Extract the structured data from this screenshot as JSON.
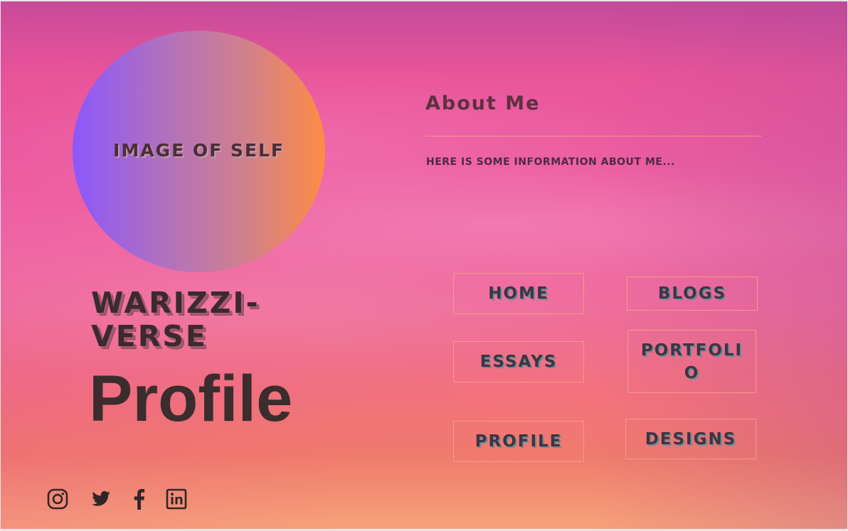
{
  "avatar": {
    "label": "IMAGE OF SELF"
  },
  "brand": {
    "name": "WARIZZI-\nVERSE",
    "subtitle": "Profile"
  },
  "about": {
    "title": "About Me",
    "text": "here is some information about me..."
  },
  "nav": {
    "home": "HOME",
    "blogs": "BLOGS",
    "essays": "ESSAYS",
    "portfolio": "PORTFOLI\nO",
    "profile": "PROFILE",
    "designs": "DESIGNS"
  },
  "social": [
    "instagram-icon",
    "twitter-icon",
    "facebook-icon",
    "linkedin-icon"
  ],
  "colors": {
    "text_dark": "#3b2a30",
    "button_border": "#f29c8f",
    "avatar_start": "#8b57fb",
    "avatar_end": "#fd8d44"
  }
}
